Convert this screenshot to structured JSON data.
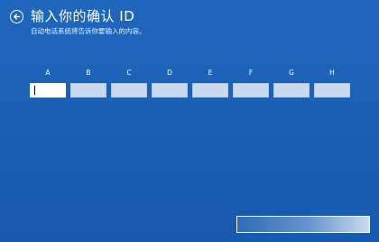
{
  "header": {
    "back_icon": "back-arrow-icon",
    "title": "输入你的确认 ID",
    "subtitle": "自动电话系统将告诉你要输入的内容。"
  },
  "id_fields": [
    {
      "label": "A",
      "value": ""
    },
    {
      "label": "B",
      "value": ""
    },
    {
      "label": "C",
      "value": ""
    },
    {
      "label": "D",
      "value": ""
    },
    {
      "label": "E",
      "value": ""
    },
    {
      "label": "F",
      "value": ""
    },
    {
      "label": "G",
      "value": ""
    },
    {
      "label": "H",
      "value": ""
    }
  ],
  "colors": {
    "background": "#1a5fb4",
    "field_fill": "#c9d9ee",
    "active_field_fill": "#ffffff"
  }
}
